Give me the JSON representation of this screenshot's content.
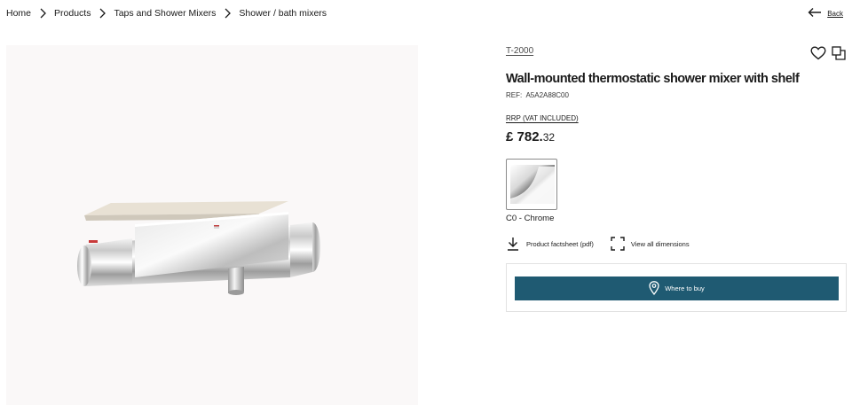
{
  "breadcrumb": {
    "items": [
      {
        "label": "Home"
      },
      {
        "label": "Products"
      },
      {
        "label": "Taps and Shower Mixers"
      },
      {
        "label": "Shower / bath mixers"
      }
    ],
    "separator_icon": "chevron-right-icon"
  },
  "back": {
    "label": "Back",
    "icon": "arrow-left-icon"
  },
  "product": {
    "collection": "T-2000",
    "title": "Wall-mounted thermostatic shower mixer with shelf",
    "ref_label": "REF:",
    "ref_value": "A5A2A88C00",
    "price_label": "RRP (VAT INCLUDED)",
    "price_whole": "£ 782.",
    "price_cents": "32",
    "finish": "C0 - Chrome",
    "image_alt": "Wall-mounted thermostatic shower mixer with shelf"
  },
  "actions": {
    "factsheet": "Product factsheet (pdf)",
    "dimensions": "View all dimensions"
  },
  "buy": {
    "label": "Where to buy",
    "icon": "location-pin-icon"
  },
  "colors": {
    "button": "#1f5a72",
    "image_background": "#faf8f8",
    "text": "#1a1a1a"
  }
}
